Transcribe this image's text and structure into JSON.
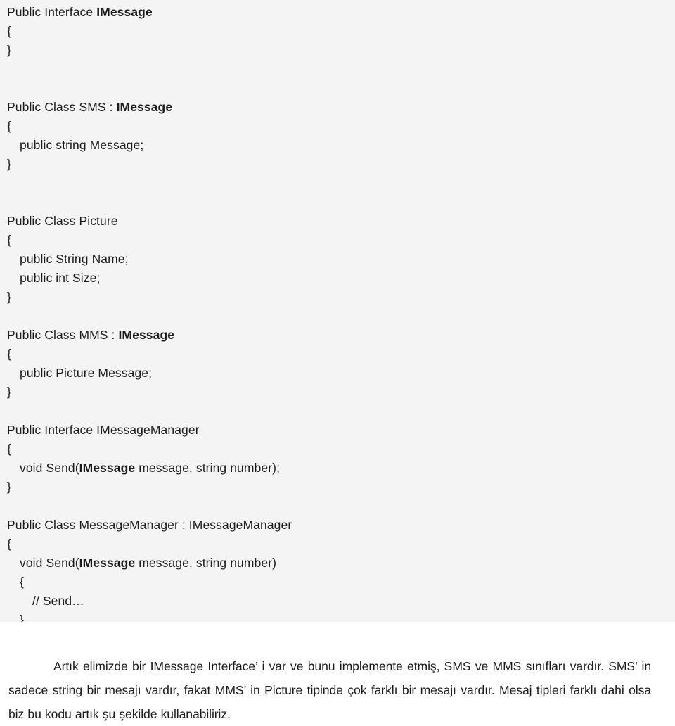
{
  "document": {
    "type": "code-listing-with-caption",
    "background_code_panel": "#f4f4f5",
    "background_page": "#ffffff",
    "text_color": "#1b1b1b"
  },
  "code": {
    "blocks": [
      {
        "name": "imessage-interface",
        "lines": [
          {
            "indent": 0,
            "segments": [
              {
                "t": "Public Interface ",
                "b": false
              },
              {
                "t": "IMessage",
                "b": true
              }
            ]
          },
          {
            "indent": 0,
            "segments": [
              {
                "t": "{",
                "b": false
              }
            ]
          },
          {
            "indent": 0,
            "segments": [
              {
                "t": "}",
                "b": false
              }
            ]
          }
        ]
      },
      {
        "name": "sms-class",
        "lines": [
          {
            "indent": 0,
            "segments": [
              {
                "t": "Public Class SMS : ",
                "b": false
              },
              {
                "t": "IMessage",
                "b": true
              }
            ]
          },
          {
            "indent": 0,
            "segments": [
              {
                "t": "{",
                "b": false
              }
            ]
          },
          {
            "indent": 1,
            "segments": [
              {
                "t": "public string Message;",
                "b": false
              }
            ]
          },
          {
            "indent": 0,
            "segments": [
              {
                "t": "}",
                "b": false
              }
            ]
          }
        ]
      },
      {
        "name": "picture-class",
        "lines": [
          {
            "indent": 0,
            "segments": [
              {
                "t": "Public Class Picture",
                "b": false
              }
            ]
          },
          {
            "indent": 0,
            "segments": [
              {
                "t": "{",
                "b": false
              }
            ]
          },
          {
            "indent": 1,
            "segments": [
              {
                "t": "public String Name;",
                "b": false
              }
            ]
          },
          {
            "indent": 1,
            "segments": [
              {
                "t": "public int Size;",
                "b": false
              }
            ]
          },
          {
            "indent": 0,
            "segments": [
              {
                "t": "}",
                "b": false
              }
            ]
          }
        ]
      },
      {
        "name": "mms-class",
        "lines": [
          {
            "indent": 0,
            "segments": [
              {
                "t": "Public Class MMS : ",
                "b": false
              },
              {
                "t": "IMessage",
                "b": true
              }
            ]
          },
          {
            "indent": 0,
            "segments": [
              {
                "t": "{",
                "b": false
              }
            ]
          },
          {
            "indent": 1,
            "segments": [
              {
                "t": "public Picture Message;",
                "b": false
              }
            ]
          },
          {
            "indent": 0,
            "segments": [
              {
                "t": "}",
                "b": false
              }
            ]
          }
        ]
      },
      {
        "name": "imessagemanager-interface",
        "lines": [
          {
            "indent": 0,
            "segments": [
              {
                "t": "Public Interface IMessageManager",
                "b": false
              }
            ]
          },
          {
            "indent": 0,
            "segments": [
              {
                "t": "{",
                "b": false
              }
            ]
          },
          {
            "indent": 1,
            "segments": [
              {
                "t": "void Send(",
                "b": false
              },
              {
                "t": "IMessage",
                "b": true
              },
              {
                "t": " message, string number);",
                "b": false
              }
            ]
          },
          {
            "indent": 0,
            "segments": [
              {
                "t": "}",
                "b": false
              }
            ]
          }
        ]
      },
      {
        "name": "messagemanager-class",
        "lines": [
          {
            "indent": 0,
            "segments": [
              {
                "t": "Public Class MessageManager : IMessageManager",
                "b": false
              }
            ]
          },
          {
            "indent": 0,
            "segments": [
              {
                "t": "{",
                "b": false
              }
            ]
          },
          {
            "indent": 1,
            "segments": [
              {
                "t": "void Send(",
                "b": false
              },
              {
                "t": "IMessage",
                "b": true
              },
              {
                "t": " message, string number)",
                "b": false
              }
            ]
          },
          {
            "indent": 1,
            "segments": [
              {
                "t": "{",
                "b": false
              }
            ]
          },
          {
            "indent": 2,
            "segments": [
              {
                "t": "// Send…",
                "b": false
              }
            ]
          },
          {
            "indent": 1,
            "segments": [
              {
                "t": "}",
                "b": false
              }
            ]
          },
          {
            "indent": 0,
            "segments": [
              {
                "t": "}",
                "b": false
              }
            ]
          }
        ]
      }
    ]
  },
  "caption": {
    "paragraph": "Artık elimizde bir IMessage Interface’ i var ve bunu implemente etmiş, SMS ve MMS sınıfları vardır. SMS’ in sadece string bir mesajı vardır, fakat MMS’ in Picture tipinde çok farklı bir mesajı vardır. Mesaj tipleri farklı dahi olsa biz bu kodu artık şu şekilde kullanabiliriz."
  }
}
